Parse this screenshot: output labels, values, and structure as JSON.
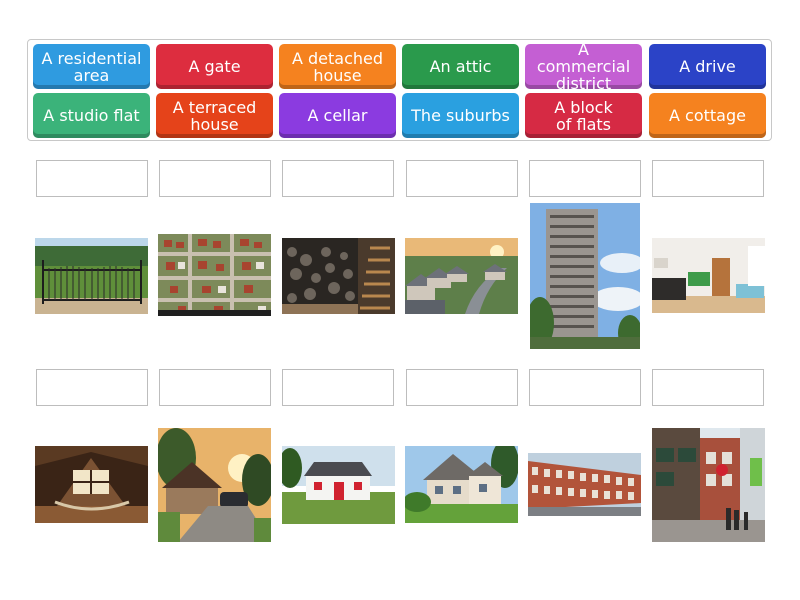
{
  "tiles": [
    {
      "label": "A residential\narea",
      "color": "#2f9be0"
    },
    {
      "label": "A gate",
      "color": "#dd2d3f"
    },
    {
      "label": "A detached\nhouse",
      "color": "#f5821f"
    },
    {
      "label": "An attic",
      "color": "#2a9a4c"
    },
    {
      "label": "A commercial\ndistrict",
      "color": "#c45fd3"
    },
    {
      "label": "A drive",
      "color": "#2b43c7"
    },
    {
      "label": "A studio flat",
      "color": "#3bb37a"
    },
    {
      "label": "A terraced\nhouse",
      "color": "#e5431a"
    },
    {
      "label": "A cellar",
      "color": "#8b3be0"
    },
    {
      "label": "The suburbs",
      "color": "#2aa0e0"
    },
    {
      "label": "A block\nof flats",
      "color": "#d62a44"
    },
    {
      "label": "A cottage",
      "color": "#f5821f"
    }
  ],
  "images": [
    {
      "icon": "gate-photo"
    },
    {
      "icon": "residential-area-aerial-photo"
    },
    {
      "icon": "cellar-stairs-photo"
    },
    {
      "icon": "suburbs-street-photo"
    },
    {
      "icon": "tower-block-photo"
    },
    {
      "icon": "studio-flat-photo"
    },
    {
      "icon": "attic-room-photo"
    },
    {
      "icon": "driveway-photo"
    },
    {
      "icon": "cottage-photo"
    },
    {
      "icon": "detached-house-photo"
    },
    {
      "icon": "terraced-houses-photo"
    },
    {
      "icon": "commercial-street-photo"
    }
  ]
}
